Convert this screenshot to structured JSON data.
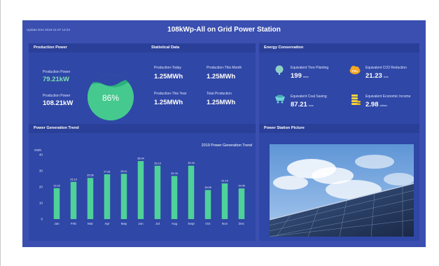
{
  "header": {
    "update_time": "Update time 2019-11-07  13:24",
    "title": "108kWp-All on Grid Power Station"
  },
  "production_power": {
    "title": "Production Power",
    "power_label": "Production Power",
    "power_value": "79.21kW",
    "capacity_label": "Production Power",
    "capacity_value": "108.21kW",
    "gauge_percent": "86%",
    "gauge_fraction": 0.86
  },
  "statistical_data": {
    "title": "Statistical Data",
    "today_label": "Production-Today",
    "today_value": "1.25MWh",
    "month_label": "Production-This Month",
    "month_value": "1.25MWh",
    "year_label": "Production-This Year",
    "year_value": "1.25MWh",
    "total_label": "Total Production",
    "total_value": "1.25MWh"
  },
  "energy_conservation": {
    "title": "Energy Conservation",
    "items": [
      {
        "label": "Equivalent Tree Planting",
        "value": "199",
        "unit": "trees",
        "icon": "tree-icon",
        "color": "#8fd1c6"
      },
      {
        "label": "Equivalent CO2 Reduction",
        "value": "21.23",
        "unit": "tons",
        "icon": "co2-cloud-icon",
        "color": "#f5a623"
      },
      {
        "label": "Equivalent Coal Saving",
        "value": "87.21",
        "unit": "tons",
        "icon": "coal-cart-icon",
        "color": "#6fd3d9"
      },
      {
        "label": "Equivalent Economic Income",
        "value": "2.98",
        "unit": "dollars",
        "icon": "coins-icon",
        "color": "#f6d33a"
      }
    ]
  },
  "power_trend": {
    "title": "Power Generation Trend"
  },
  "station_picture": {
    "title": "Power Station Picture"
  },
  "colors": {
    "background": "#3a4fb0",
    "card": "#2f47a6",
    "bar": "#4fd19a",
    "gauge": "#3fbf8a",
    "accent_text": "#7fe0b2"
  },
  "chart_data": {
    "type": "bar",
    "title": "2019 Power Generation Trend",
    "ylabel": "GWh",
    "ylim": [
      0,
      40
    ],
    "yticks": [
      0,
      10,
      20,
      30,
      40
    ],
    "grid": false,
    "categories": [
      "Jan",
      "Feb",
      "Mar",
      "Apr",
      "May",
      "Jun",
      "Jul",
      "Aug",
      "Sept",
      "Oct",
      "Nov",
      "Dec"
    ],
    "values": [
      19.23,
      23.13,
      25.56,
      27.81,
      28.11,
      36.04,
      33.13,
      26.78,
      33.16,
      18.06,
      22.19,
      19.06
    ],
    "data_labels": [
      "19.23",
      "23.13",
      "25.56",
      "27.81",
      "28.11",
      "36.04",
      "33.13",
      "26.78",
      "33.16",
      "18.06",
      "22.19",
      "19.06"
    ]
  }
}
